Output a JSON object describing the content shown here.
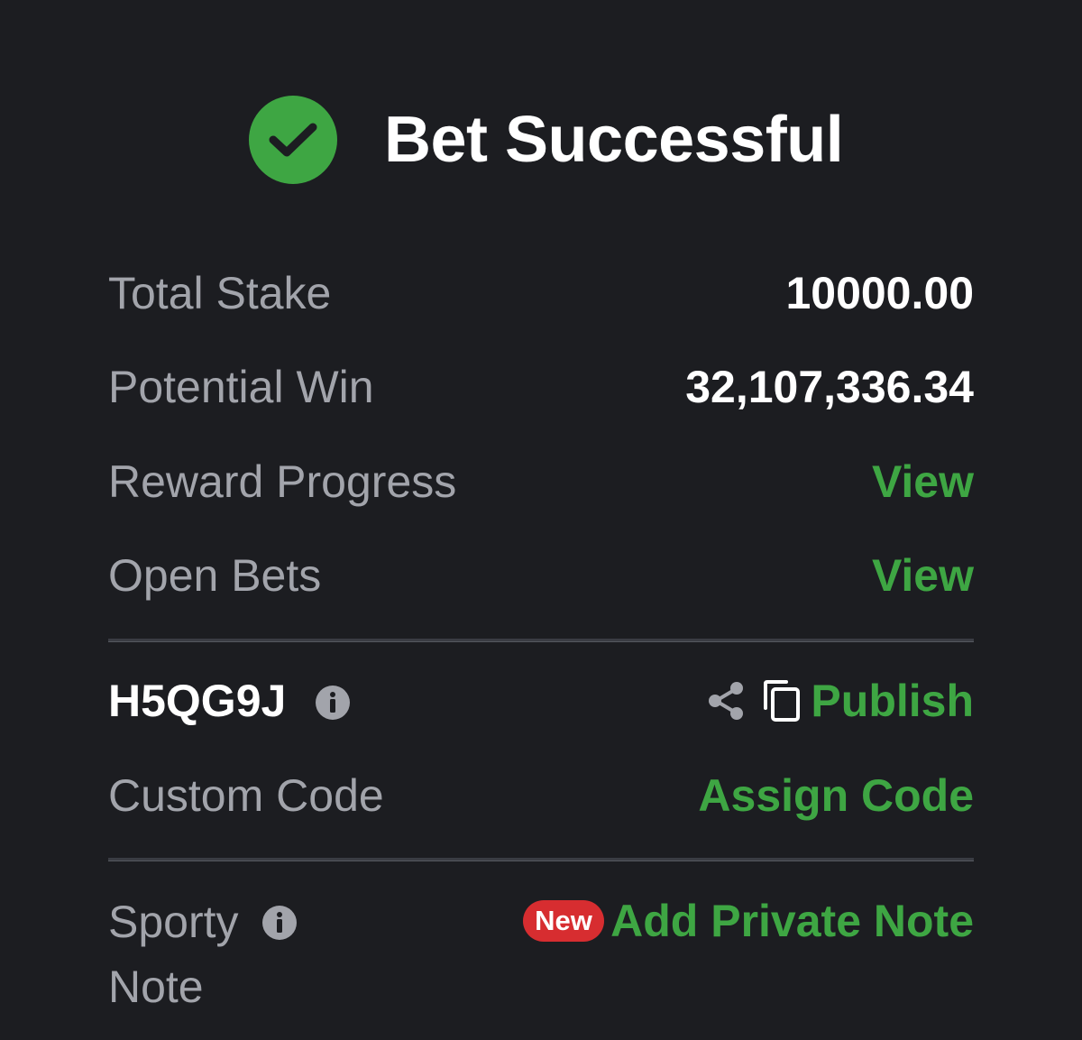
{
  "header": {
    "title": "Bet Successful"
  },
  "summary": {
    "total_stake_label": "Total Stake",
    "total_stake_value": "10000.00",
    "potential_win_label": "Potential Win",
    "potential_win_value": "32,107,336.34",
    "reward_progress_label": "Reward Progress",
    "reward_progress_link": "View",
    "open_bets_label": "Open Bets",
    "open_bets_link": "View"
  },
  "booking": {
    "code": "H5QG9J",
    "publish_label": "Publish",
    "custom_code_label": "Custom Code",
    "assign_code_label": "Assign Code"
  },
  "note": {
    "label_line1": "Sporty",
    "label_line2": "Note",
    "badge": "New",
    "add_note_label": "Add Private Note"
  },
  "colors": {
    "background": "#1c1d21",
    "accent_green": "#3ea643",
    "label_gray": "#a2a4ab",
    "badge_red": "#d72d30"
  },
  "icons": [
    "check-circle-icon",
    "info-icon",
    "share-icon",
    "copy-icon"
  ]
}
